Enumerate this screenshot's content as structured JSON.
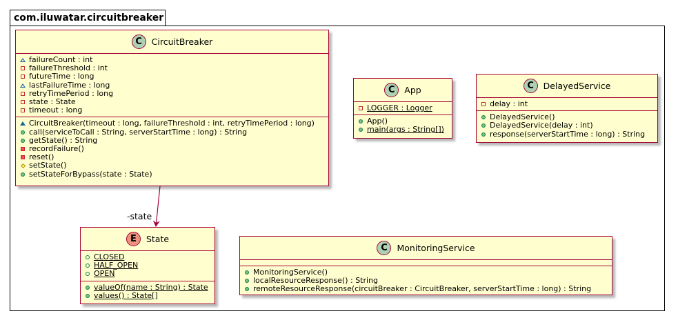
{
  "package": {
    "name": "com.iluwatar.circuitbreaker"
  },
  "classes": {
    "circuit_breaker": {
      "name": "CircuitBreaker",
      "stereotype": "C",
      "fields": [
        {
          "vis": "pkg-field",
          "text": "failureCount : int"
        },
        {
          "vis": "priv-field",
          "text": "failureThreshold : int"
        },
        {
          "vis": "priv-field",
          "text": "futureTime : long"
        },
        {
          "vis": "pkg-field",
          "text": "lastFailureTime : long"
        },
        {
          "vis": "priv-field",
          "text": "retryTimePeriod : long"
        },
        {
          "vis": "priv-field",
          "text": "state : State"
        },
        {
          "vis": "priv-field",
          "text": "timeout : long"
        }
      ],
      "methods": [
        {
          "vis": "pkg-method",
          "text": "CircuitBreaker(timeout : long, failureThreshold : int, retryTimePeriod : long)"
        },
        {
          "vis": "pub-method",
          "text": "call(serviceToCall : String, serverStartTime : long) : String"
        },
        {
          "vis": "pub-method",
          "text": "getState() : String"
        },
        {
          "vis": "priv-method",
          "text": "recordFailure()"
        },
        {
          "vis": "priv-method",
          "text": "reset()"
        },
        {
          "vis": "prot-method",
          "text": "setState()"
        },
        {
          "vis": "pub-method",
          "text": "setStateForBypass(state : State)"
        }
      ]
    },
    "app": {
      "name": "App",
      "stereotype": "C",
      "fields": [
        {
          "vis": "priv-field",
          "text": "LOGGER : Logger",
          "static": true
        }
      ],
      "methods": [
        {
          "vis": "pub-method",
          "text": "App()"
        },
        {
          "vis": "pub-method",
          "text": "main(args : String[])",
          "static": true
        }
      ]
    },
    "delayed_service": {
      "name": "DelayedService",
      "stereotype": "C",
      "fields": [
        {
          "vis": "priv-field",
          "text": "delay : int"
        }
      ],
      "methods": [
        {
          "vis": "pub-method",
          "text": "DelayedService()"
        },
        {
          "vis": "pub-method",
          "text": "DelayedService(delay : int)"
        },
        {
          "vis": "pub-method",
          "text": "response(serverStartTime : long) : String"
        }
      ]
    },
    "state": {
      "name": "State",
      "stereotype": "E",
      "fields": [
        {
          "vis": "pub-field",
          "text": "CLOSED",
          "static": true
        },
        {
          "vis": "pub-field",
          "text": "HALF_OPEN",
          "static": true
        },
        {
          "vis": "pub-field",
          "text": "OPEN",
          "static": true
        }
      ],
      "methods": [
        {
          "vis": "pub-method",
          "text": "valueOf(name : String) : State",
          "static": true
        },
        {
          "vis": "pub-method",
          "text": "values() : State[]",
          "static": true
        }
      ]
    },
    "monitoring_service": {
      "name": "MonitoringService",
      "stereotype": "C",
      "fields": [],
      "methods": [
        {
          "vis": "pub-method",
          "text": "MonitoringService()"
        },
        {
          "vis": "pub-method",
          "text": "localResourceResponse() : String"
        },
        {
          "vis": "pub-method",
          "text": "remoteResourceResponse(circuitBreaker : CircuitBreaker, serverStartTime : long) : String"
        }
      ]
    }
  },
  "associations": [
    {
      "from": "CircuitBreaker",
      "to": "State",
      "label": "-state"
    }
  ],
  "colors": {
    "class_fill": "#FEFECE",
    "class_border": "#A80036",
    "class_badge": "#ADD1B2",
    "enum_badge": "#EB937F"
  }
}
